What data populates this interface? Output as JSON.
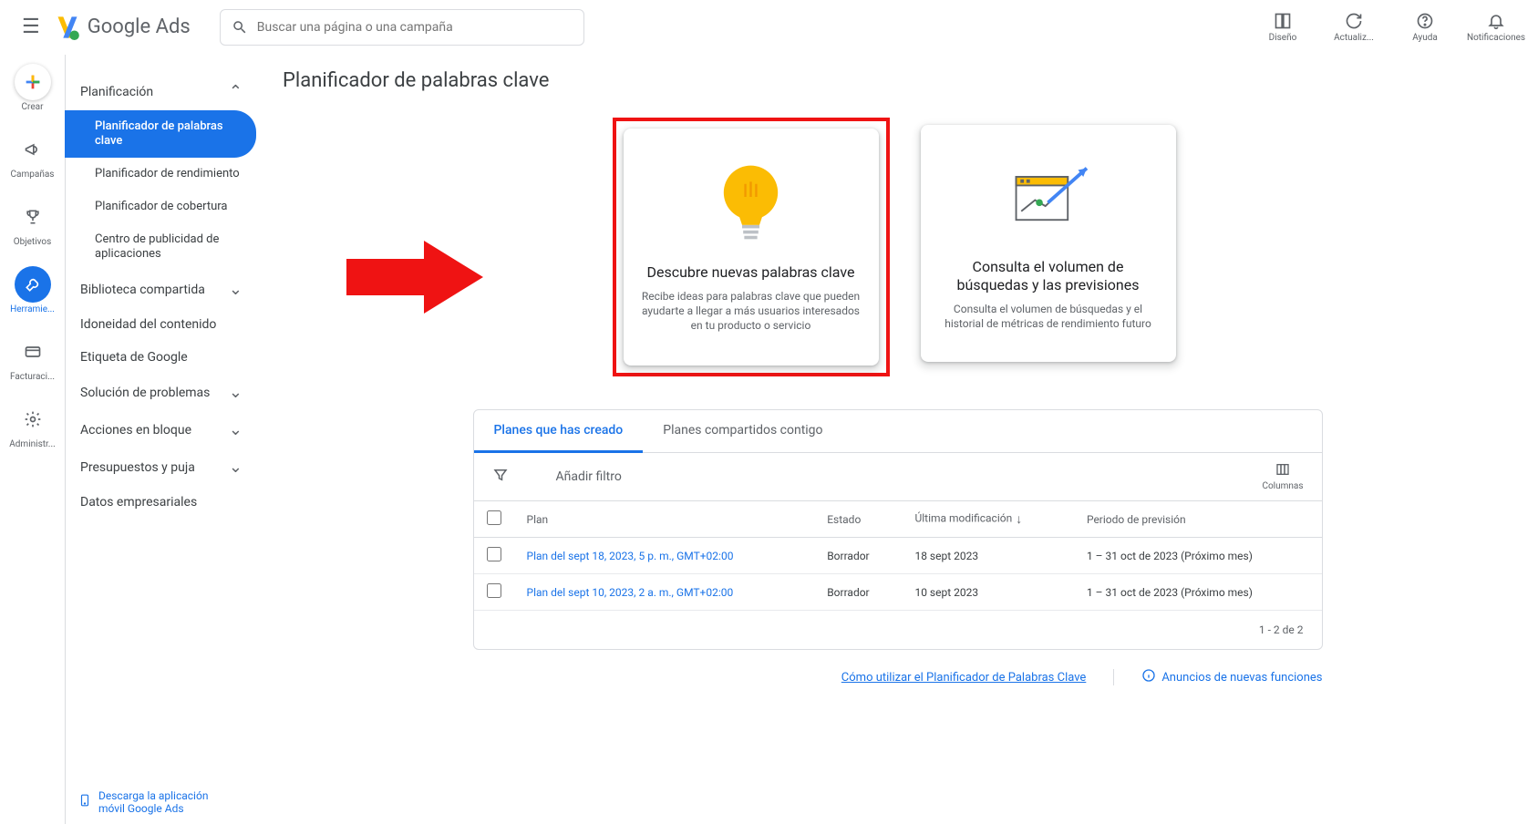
{
  "header": {
    "brand": "Google Ads",
    "search_placeholder": "Buscar una página o una campaña",
    "actions": {
      "design": "Diseño",
      "refresh": "Actualiz...",
      "help": "Ayuda",
      "notifications": "Notificaciones"
    }
  },
  "rail": {
    "create": "Crear",
    "campaigns": "Campañas",
    "goals": "Objetivos",
    "tools": "Herramie...",
    "billing": "Facturaci...",
    "admin": "Administr..."
  },
  "sidebar": {
    "planning": "Planificación",
    "planning_items": {
      "keyword_planner": "Planificador de palabras clave",
      "performance_planner": "Planificador de rendimiento",
      "reach_planner": "Planificador de cobertura",
      "app_advertising_hub": "Centro de publicidad de aplicaciones"
    },
    "shared_library": "Biblioteca compartida",
    "content_suitability": "Idoneidad del contenido",
    "google_tag": "Etiqueta de Google",
    "troubleshooting": "Solución de problemas",
    "bulk_actions": "Acciones en bloque",
    "budgets_bidding": "Presupuestos y puja",
    "business_data": "Datos empresariales",
    "footer_download": "Descarga la aplicación móvil Google Ads"
  },
  "main": {
    "title": "Planificador de palabras clave",
    "card_discover": {
      "title": "Descubre nuevas palabras clave",
      "desc": "Recibe ideas para palabras clave que pueden ayudarte a llegar a más usuarios interesados en tu producto o servicio"
    },
    "card_volume": {
      "title": "Consulta el volumen de búsquedas y las previsiones",
      "desc": "Consulta el volumen de búsquedas y el historial de métricas de rendimiento futuro"
    }
  },
  "plans": {
    "tab_created": "Planes que has creado",
    "tab_shared": "Planes compartidos contigo",
    "add_filter": "Añadir filtro",
    "columns_label": "Columnas",
    "col_plan": "Plan",
    "col_state": "Estado",
    "col_modified": "Última modificación",
    "col_period": "Periodo de previsión",
    "rows": [
      {
        "plan": "Plan del sept 18, 2023, 5 p. m., GMT+02:00",
        "state": "Borrador",
        "modified": "18 sept 2023",
        "period": "1 – 31 oct de 2023 (Próximo mes)"
      },
      {
        "plan": "Plan del sept 10, 2023, 2 a. m., GMT+02:00",
        "state": "Borrador",
        "modified": "10 sept 2023",
        "period": "1 – 31 oct de 2023 (Próximo mes)"
      }
    ],
    "pagination": "1 - 2 de 2"
  },
  "footer": {
    "how_to": "Cómo utilizar el Planificador de Palabras Clave",
    "new_features": "Anuncios de nuevas funciones"
  }
}
